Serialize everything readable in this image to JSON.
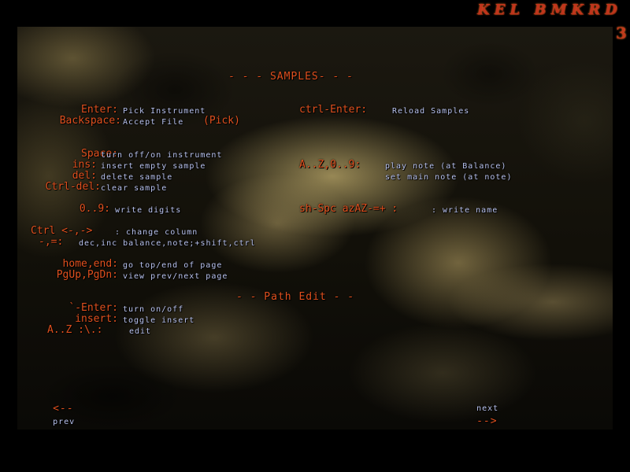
{
  "app": {
    "logo": "KEL BMKRD",
    "page_number": "3"
  },
  "samples": {
    "header": "- - - SAMPLES- - -",
    "bindings": [
      {
        "key": "Enter:",
        "desc": "Pick Instrument"
      },
      {
        "key": "Backspace:",
        "desc": "Accept File",
        "extra": "(Pick)"
      },
      {
        "key": "ctrl-Enter:",
        "desc": "Reload Samples"
      },
      {
        "key": "Space:",
        "desc": "turn off/on instrument"
      },
      {
        "key": "ins:",
        "desc": "insert empty sample"
      },
      {
        "key": "del:",
        "desc": "delete sample"
      },
      {
        "key": "Ctrl-del:",
        "desc": "clear sample"
      },
      {
        "key": "A..Z,0..9:",
        "desc": "play note (at Balance)"
      },
      {
        "desc": "set main note (at note)"
      },
      {
        "key": "0..9:",
        "desc": "write digits"
      },
      {
        "key": "sh-Spc azAZ-=+ :",
        "desc": ": write name"
      },
      {
        "key": "Ctrl <-,->",
        "desc": ": change column"
      },
      {
        "key": "-,=:",
        "desc": "dec,inc balance,note;+shift,ctrl"
      },
      {
        "key": "home,end:",
        "desc": "go top/end of page"
      },
      {
        "key": "PgUp,PgDn:",
        "desc": "view prev/next page"
      }
    ]
  },
  "path_edit": {
    "header": "- - Path Edit - -",
    "bindings": [
      {
        "key": "`-Enter:",
        "desc": "turn on/off"
      },
      {
        "key": "insert:",
        "desc": "toggle insert"
      },
      {
        "key": "A..Z :\\.:",
        "desc": "edit"
      }
    ]
  },
  "navigation": {
    "prev_arrow": "<--",
    "prev_label": "prev",
    "next_label": "next",
    "next_arrow": "-->"
  },
  "colors": {
    "key": "#e0501e",
    "desc": "#b8c2ee",
    "logo": "#c0341c"
  }
}
